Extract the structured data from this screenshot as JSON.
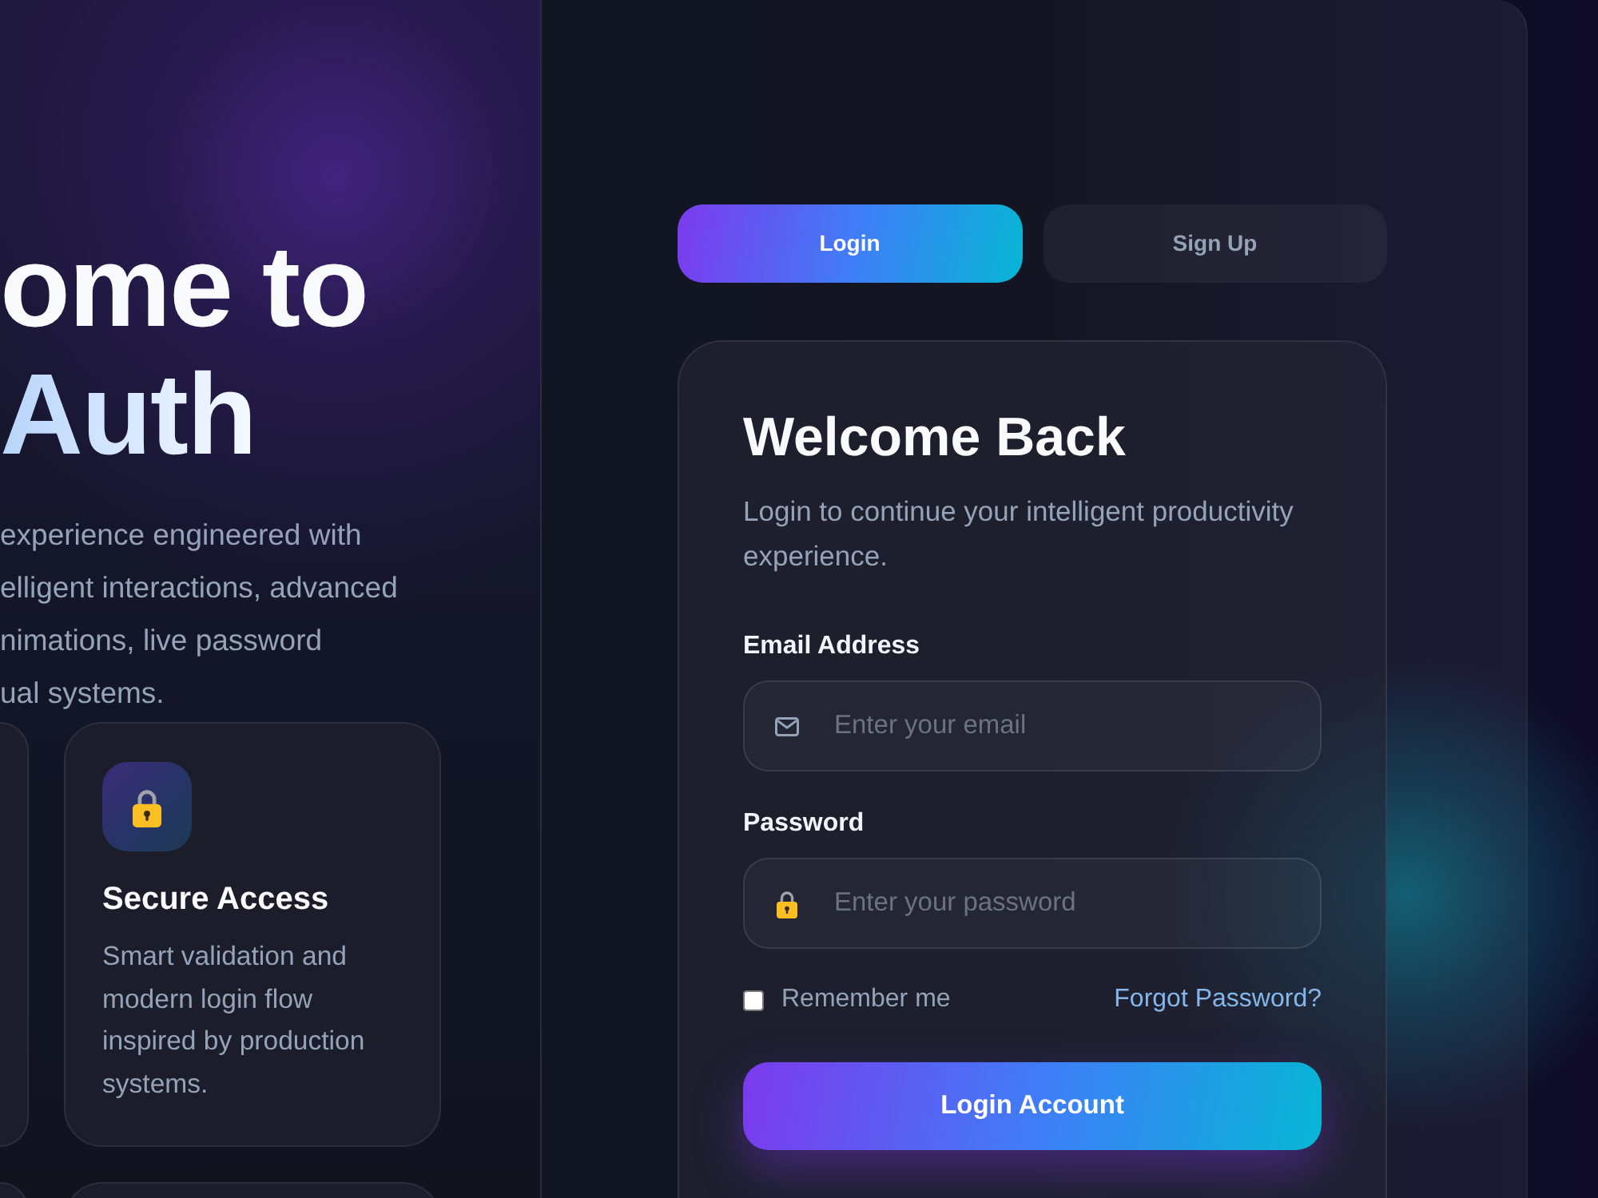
{
  "hero": {
    "heading_lines": [
      "ome to",
      "Auth"
    ],
    "description_lines": [
      "experience engineered with",
      "elligent interactions, advanced",
      "nimations, live password",
      "ual systems."
    ]
  },
  "feature_cards": [
    {
      "title": "Secure Access",
      "text": "Smart validation and modern login flow inspired by production systems."
    }
  ],
  "auth_tabs": [
    {
      "label": "Login",
      "selected": true
    },
    {
      "label": "Sign Up",
      "selected": false
    }
  ],
  "login_form": {
    "title": "Welcome Back",
    "subtitle": "Login to continue your intelligent productivity experience.",
    "fields": [
      {
        "kind": "email",
        "label": "Email Address",
        "placeholder": "Enter your email"
      },
      {
        "kind": "password",
        "label": "Password",
        "placeholder": "Enter your password"
      }
    ],
    "remember_me": {
      "label": "Remember me",
      "checked": false
    },
    "forgot_password": "Forgot Password?",
    "submit": "Login Account"
  }
}
